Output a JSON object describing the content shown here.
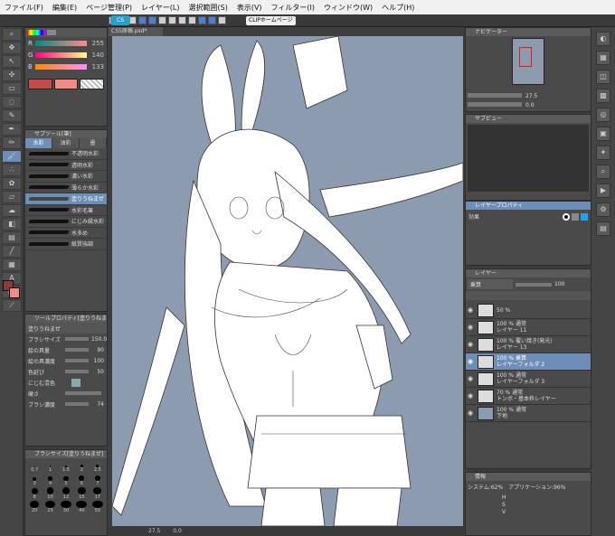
{
  "menu": [
    "ファイル(F)",
    "編集(E)",
    "ページ管理(P)",
    "レイヤー(L)",
    "選択範囲(S)",
    "表示(V)",
    "フィルター(I)",
    "ウィンドウ(W)",
    "ヘルプ(H)"
  ],
  "toolbar": {
    "clip_label": "CLIPホームページ",
    "logo": "CS"
  },
  "document": {
    "tab": "CS5原稿.psd*"
  },
  "color": {
    "labels": [
      "R",
      "G",
      "B"
    ],
    "values": [
      "255",
      "140",
      "133"
    ],
    "main": "#f08c85",
    "sub": "#e87c7c"
  },
  "subtool": {
    "title": "サブツール[筆]",
    "tabs": [
      "水彩",
      "油彩",
      "墨"
    ],
    "brushes": [
      "不透明水彩",
      "透明水彩",
      "濃い水彩",
      "薄らか水彩",
      "塗りうねまぜ",
      "水彩毛筆",
      "にじみ縁水彩",
      "水多め",
      "紙質強調"
    ],
    "selected": 4
  },
  "toolprop": {
    "title": "ツールプロパティ[塗りうねまぜ]",
    "name": "塗りうねまぜ",
    "props": [
      {
        "label": "ブラシサイズ",
        "value": "150.0"
      },
      {
        "label": "絵の具量",
        "value": "90"
      },
      {
        "label": "絵の具濃度",
        "value": "100"
      },
      {
        "label": "色延び",
        "value": "50"
      },
      {
        "label": "にじむ混色",
        "value": ""
      },
      {
        "label": "硬さ",
        "value": ""
      },
      {
        "label": "ブラシ濃度",
        "value": "74"
      }
    ]
  },
  "brushsize": {
    "title": "ブラシサイズ[塗りうねまぜ]",
    "sizes": [
      "0.7",
      "1",
      "1.5",
      "2",
      "2.5",
      "3",
      "4",
      "5",
      "6",
      "7",
      "8",
      "10",
      "12",
      "15",
      "17",
      "20",
      "25",
      "30",
      "40",
      "50"
    ]
  },
  "navigator": {
    "title": "ナビゲーター",
    "zoom": "27.5",
    "rotate": "0.0"
  },
  "subview": {
    "title": "サブビュー"
  },
  "layerprop": {
    "title": "レイヤープロパティ",
    "effect": "効果"
  },
  "layers": {
    "title": "レイヤー",
    "blend": "乗算",
    "opacity": "100",
    "items": [
      {
        "l1": "50 %",
        "l2": ""
      },
      {
        "l1": "100 % 通常",
        "l2": "レイヤー 11"
      },
      {
        "l1": "100 % 覆い焼き(発光)",
        "l2": "レイヤー 13"
      },
      {
        "l1": "100 % 乗算",
        "l2": "レイヤーフォルダ 2"
      },
      {
        "l1": "100 % 通常",
        "l2": "レイヤーフォルダ 3"
      },
      {
        "l1": "70 % 通常",
        "l2": "トンボ・基本枠レイヤー"
      },
      {
        "l1": "100 % 通常",
        "l2": "下地"
      }
    ],
    "selected": 3
  },
  "info": {
    "title": "情報",
    "system": "システム:62%",
    "app": "アプリケーション:96%",
    "h": "H",
    "s": "S",
    "v": "V"
  },
  "status": {
    "zoom": "27.5",
    "angle": "0.0"
  }
}
